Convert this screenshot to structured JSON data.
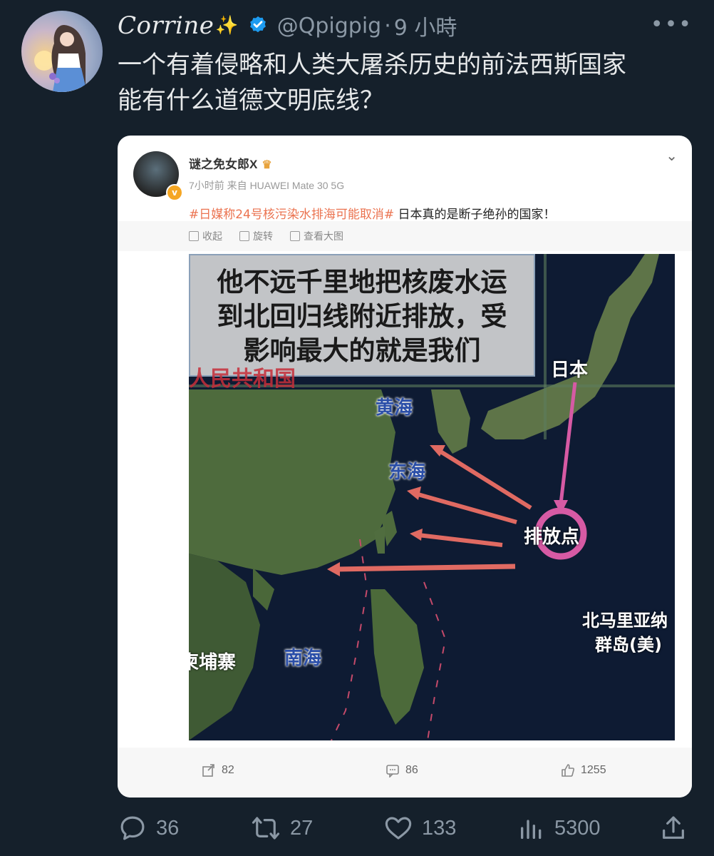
{
  "tweet": {
    "display_name": "Corrine",
    "handle": "@Qpigpig",
    "separator": "·",
    "time": "9 小時",
    "more": "•••",
    "text_line1": "一个有着侵略和人类大屠杀历史的前法西斯国家",
    "text_line2": "能有什么道德文明底线？"
  },
  "weibo": {
    "username": "谜之免女郎X",
    "meta": "7小时前  来自 HUAWEI Mate 30 5G",
    "hashtag": "#日媒称24号核污染水排海可能取消#",
    "text": " 日本真的是断子绝孙的国家！",
    "tools": [
      "收起",
      "旋转",
      "查看大图"
    ],
    "image": {
      "overlay_line1": "他不远千里地把核废水运",
      "overlay_line2": "到北回归线附近排放，受",
      "overlay_line3": "影响最大的就是我们",
      "country_fragment": "人民共和国",
      "japan": "日本",
      "yellow_sea": "黄海",
      "east_sea": "东海",
      "discharge": "排放点",
      "south_sea": "南海",
      "cambodia": "柬埔寨",
      "mariana_1": "北马里亚纳",
      "mariana_2": "群岛(美)"
    },
    "actions": {
      "forward": "82",
      "comment": "86",
      "like": "1255"
    }
  },
  "actions": {
    "reply": "36",
    "retweet": "27",
    "like": "133",
    "views": "5300"
  }
}
